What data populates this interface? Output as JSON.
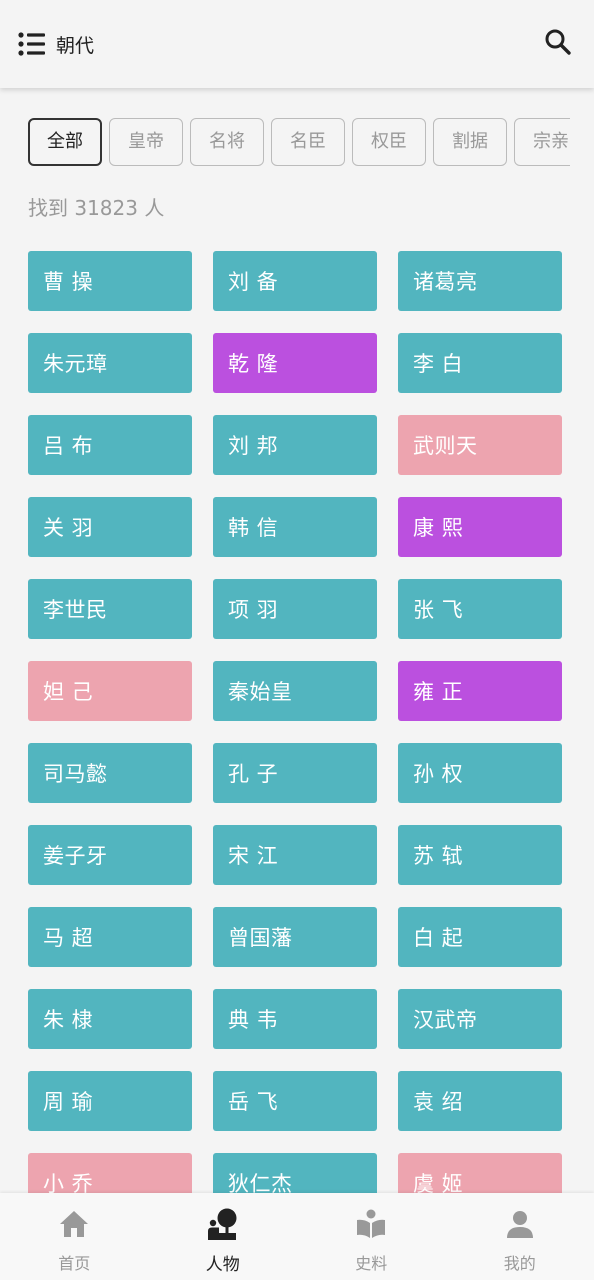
{
  "header": {
    "menu_icon": "list-menu-icon",
    "title": "朝代",
    "search_icon": "search-icon"
  },
  "filters": [
    {
      "label": "全部",
      "active": true
    },
    {
      "label": "皇帝",
      "active": false
    },
    {
      "label": "名将",
      "active": false
    },
    {
      "label": "名臣",
      "active": false
    },
    {
      "label": "权臣",
      "active": false
    },
    {
      "label": "割据",
      "active": false
    },
    {
      "label": "宗亲",
      "active": false
    }
  ],
  "result_count": "找到 31823 人",
  "colors": {
    "teal": "#52b5bf",
    "purple": "#bb50df",
    "pink": "#eda4af",
    "background": "#f4f4f4"
  },
  "people": [
    {
      "name": "曹 操",
      "color": "teal"
    },
    {
      "name": "刘 备",
      "color": "teal"
    },
    {
      "name": "诸葛亮",
      "color": "teal"
    },
    {
      "name": "朱元璋",
      "color": "teal"
    },
    {
      "name": "乾 隆",
      "color": "purple"
    },
    {
      "name": "李 白",
      "color": "teal"
    },
    {
      "name": "吕 布",
      "color": "teal"
    },
    {
      "name": "刘 邦",
      "color": "teal"
    },
    {
      "name": "武则天",
      "color": "pink"
    },
    {
      "name": "关 羽",
      "color": "teal"
    },
    {
      "name": "韩 信",
      "color": "teal"
    },
    {
      "name": "康 熙",
      "color": "purple"
    },
    {
      "name": "李世民",
      "color": "teal"
    },
    {
      "name": "项 羽",
      "color": "teal"
    },
    {
      "name": "张 飞",
      "color": "teal"
    },
    {
      "name": "妲 己",
      "color": "pink"
    },
    {
      "name": "秦始皇",
      "color": "teal"
    },
    {
      "name": "雍 正",
      "color": "purple"
    },
    {
      "name": "司马懿",
      "color": "teal"
    },
    {
      "name": "孔 子",
      "color": "teal"
    },
    {
      "name": "孙 权",
      "color": "teal"
    },
    {
      "name": "姜子牙",
      "color": "teal"
    },
    {
      "name": "宋 江",
      "color": "teal"
    },
    {
      "name": "苏 轼",
      "color": "teal"
    },
    {
      "name": "马 超",
      "color": "teal"
    },
    {
      "name": "曾国藩",
      "color": "teal"
    },
    {
      "name": "白 起",
      "color": "teal"
    },
    {
      "name": "朱 棣",
      "color": "teal"
    },
    {
      "name": "典 韦",
      "color": "teal"
    },
    {
      "name": "汉武帝",
      "color": "teal"
    },
    {
      "name": "周 瑜",
      "color": "teal"
    },
    {
      "name": "岳 飞",
      "color": "teal"
    },
    {
      "name": "袁 绍",
      "color": "teal"
    },
    {
      "name": "小 乔",
      "color": "pink"
    },
    {
      "name": "狄仁杰",
      "color": "teal"
    },
    {
      "name": "虞 姬",
      "color": "pink"
    }
  ],
  "bottom_nav": [
    {
      "label": "首页",
      "icon": "home-icon",
      "active": false
    },
    {
      "label": "人物",
      "icon": "person-icon",
      "active": true
    },
    {
      "label": "史料",
      "icon": "open-book-icon",
      "active": false
    },
    {
      "label": "我的",
      "icon": "profile-icon",
      "active": false
    }
  ]
}
